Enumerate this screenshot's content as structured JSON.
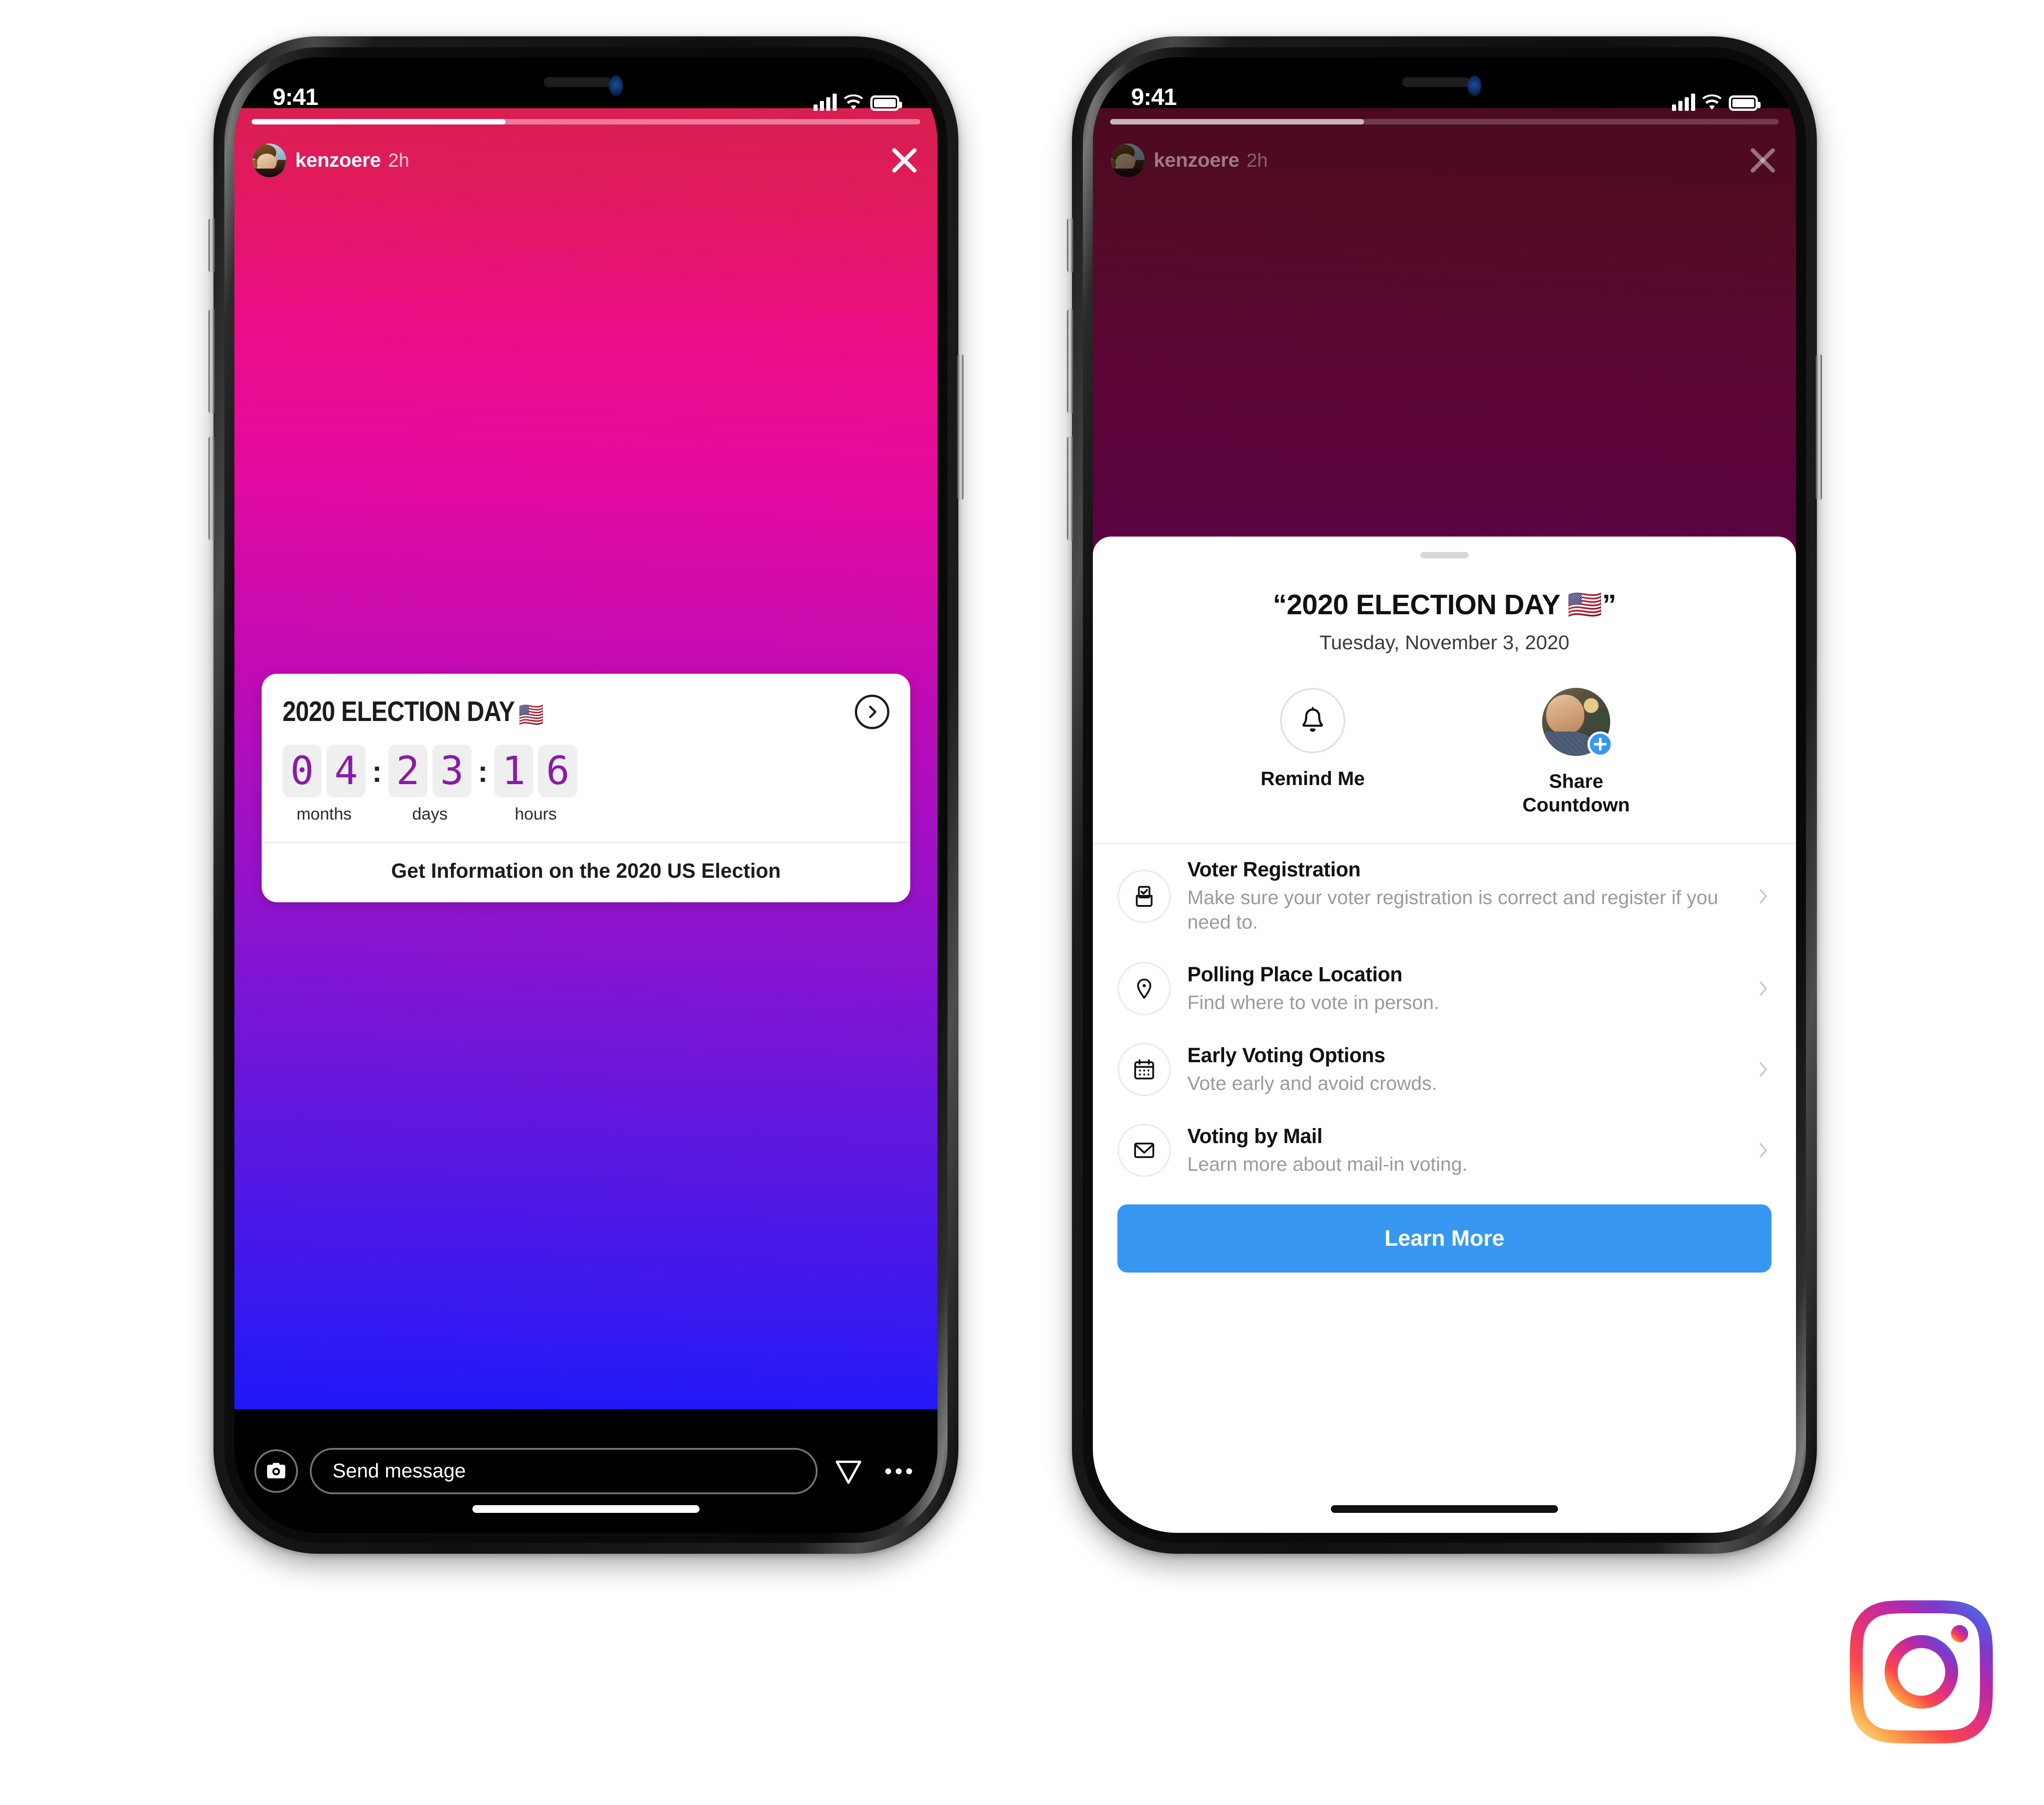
{
  "statusbar": {
    "time": "9:41"
  },
  "story": {
    "username": "kenzoere",
    "timestamp": "2h",
    "progress_percent": 38,
    "close_label": "Close",
    "footer": {
      "message_placeholder": "Send message",
      "camera_label": "Camera",
      "send_label": "Send",
      "more_label": "More options"
    },
    "gradient": {
      "top": "#d81f4e",
      "mid": "#9113cc",
      "bottom": "#0a14ff"
    }
  },
  "sticker": {
    "title": "2020 ELECTION DAY",
    "flag": "🇺🇸",
    "cta": "Get Information on the 2020 US Election",
    "chevron": "chevron-right-icon",
    "countdown": {
      "groups": [
        {
          "label": "months",
          "digits": [
            "0",
            "4"
          ]
        },
        {
          "label": "days",
          "digits": [
            "2",
            "3"
          ]
        },
        {
          "label": "hours",
          "digits": [
            "1",
            "6"
          ]
        }
      ],
      "separator": ":",
      "digit_color": "#8a1ba8"
    }
  },
  "sheet": {
    "title": "“2020 ELECTION DAY 🇺🇸”",
    "subtitle": "Tuesday, November 3, 2020",
    "actions": [
      {
        "label": "Remind Me",
        "icon": "bell-icon"
      },
      {
        "label": "Share\nCountdown",
        "icon": "profile-photo"
      }
    ],
    "rows": [
      {
        "title": "Voter Registration",
        "desc": "Make sure your voter registration is correct and register if you need to.",
        "icon": "ballot-check-icon"
      },
      {
        "title": "Polling Place Location",
        "desc": "Find where to vote in person.",
        "icon": "location-pin-icon"
      },
      {
        "title": "Early Voting Options",
        "desc": "Vote early and avoid crowds.",
        "icon": "calendar-icon"
      },
      {
        "title": "Voting by Mail",
        "desc": "Learn more about mail-in voting.",
        "icon": "envelope-icon"
      }
    ],
    "learn_more_label": "Learn More",
    "accent_color": "#3897f0"
  },
  "brand": {
    "logo": "instagram-logo"
  }
}
